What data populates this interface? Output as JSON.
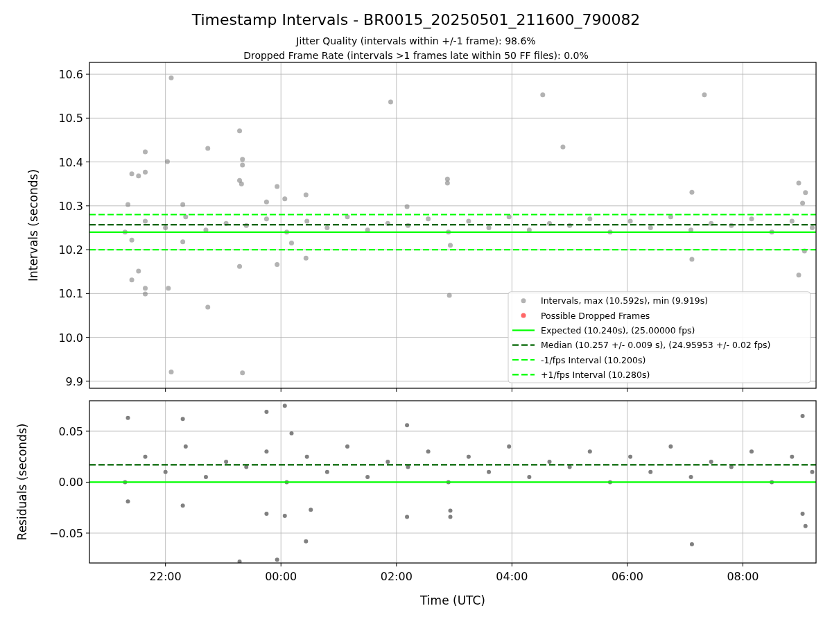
{
  "figure": {
    "title": "Timestamp Intervals - BR0015_20250501_211600_790082",
    "subtitles": [
      "Jitter Quality (intervals within +/-1 frame): 98.6%",
      "Dropped Frame Rate (intervals >1 frames late within 50 FF files): 0.0%"
    ]
  },
  "panels": [
    {
      "chart_data": {
        "type": "scatter",
        "ylabel": "Intervals (seconds)",
        "grid": true,
        "legend": true,
        "xlim": [
          "2025-05-01T20:41",
          "2025-05-02T09:16"
        ],
        "ylim": [
          9.884,
          10.627
        ],
        "yticks": [
          {
            "value": 9.9,
            "label": "9.9"
          },
          {
            "value": 10.0,
            "label": "10.0"
          },
          {
            "value": 10.1,
            "label": "10.1"
          },
          {
            "value": 10.2,
            "label": "10.2"
          },
          {
            "value": 10.3,
            "label": "10.3"
          },
          {
            "value": 10.4,
            "label": "10.4"
          },
          {
            "value": 10.5,
            "label": "10.5"
          },
          {
            "value": 10.6,
            "label": "10.6"
          }
        ],
        "series": [
          {
            "name": "Intervals, max (10.592s), min (9.919s)",
            "color": "#808080",
            "x": [
              "2025-05-01T21:18",
              "2025-05-01T21:39",
              "2025-05-01T22:00",
              "2025-05-01T22:21",
              "2025-05-01T22:42",
              "2025-05-01T23:03",
              "2025-05-01T23:24",
              "2025-05-01T23:45",
              "2025-05-02T00:06",
              "2025-05-02T00:27",
              "2025-05-02T00:48",
              "2025-05-02T01:09",
              "2025-05-02T01:30",
              "2025-05-02T01:51",
              "2025-05-02T02:12",
              "2025-05-02T02:33",
              "2025-05-02T02:54",
              "2025-05-02T03:15",
              "2025-05-02T03:36",
              "2025-05-02T03:57",
              "2025-05-02T04:18",
              "2025-05-02T04:39",
              "2025-05-02T05:00",
              "2025-05-02T05:21",
              "2025-05-02T05:42",
              "2025-05-02T06:03",
              "2025-05-02T06:24",
              "2025-05-02T06:45",
              "2025-05-02T07:06",
              "2025-05-02T07:27",
              "2025-05-02T07:48",
              "2025-05-02T08:09",
              "2025-05-02T08:30",
              "2025-05-02T08:51",
              "2025-05-02T09:12",
              "2025-05-01T21:21",
              "2025-05-01T21:25",
              "2025-05-01T21:25",
              "2025-05-01T21:25",
              "2025-05-01T21:32",
              "2025-05-01T21:32",
              "2025-05-01T21:39",
              "2025-05-01T21:39",
              "2025-05-01T21:39",
              "2025-05-01T21:39",
              "2025-05-01T22:02",
              "2025-05-01T22:06",
              "2025-05-01T22:03",
              "2025-05-01T22:06",
              "2025-05-01T22:18",
              "2025-05-01T22:18",
              "2025-05-01T22:44",
              "2025-05-01T22:44",
              "2025-05-01T23:17",
              "2025-05-01T23:20",
              "2025-05-01T23:20",
              "2025-05-01T23:17",
              "2025-05-01T23:19",
              "2025-05-01T23:17",
              "2025-05-01T23:20",
              "2025-05-01T23:45",
              "2025-05-01T23:56",
              "2025-05-01T23:56",
              "2025-05-02T00:04",
              "2025-05-02T00:11",
              "2025-05-02T00:26",
              "2025-05-02T00:26",
              "2025-05-02T01:54",
              "2025-05-02T02:11",
              "2025-05-02T02:53",
              "2025-05-02T02:53",
              "2025-05-02T02:55",
              "2025-05-02T02:56",
              "2025-05-02T04:32",
              "2025-05-02T04:53",
              "2025-05-02T07:07",
              "2025-05-02T07:07",
              "2025-05-02T07:20",
              "2025-05-02T08:58",
              "2025-05-02T08:58",
              "2025-05-02T09:02",
              "2025-05-02T09:05",
              "2025-05-02T09:04"
            ],
            "values": [
              10.24,
              10.265,
              10.25,
              10.275,
              10.245,
              10.26,
              10.255,
              10.27,
              10.24,
              10.265,
              10.25,
              10.275,
              10.245,
              10.26,
              10.255,
              10.27,
              10.24,
              10.265,
              10.25,
              10.275,
              10.245,
              10.26,
              10.255,
              10.27,
              10.24,
              10.265,
              10.25,
              10.275,
              10.245,
              10.26,
              10.255,
              10.27,
              10.24,
              10.265,
              10.25,
              10.303,
              10.373,
              10.222,
              10.131,
              10.368,
              10.151,
              10.377,
              10.423,
              10.112,
              10.099,
              10.401,
              10.592,
              10.112,
              9.921,
              10.303,
              10.218,
              10.431,
              10.069,
              10.471,
              10.406,
              10.393,
              10.358,
              10.35,
              10.162,
              9.919,
              10.309,
              10.344,
              10.166,
              10.316,
              10.215,
              10.325,
              10.181,
              10.537,
              10.298,
              10.361,
              10.352,
              10.096,
              10.21,
              10.553,
              10.434,
              10.331,
              10.178,
              10.553,
              10.352,
              10.142,
              10.306,
              10.33,
              10.197
            ]
          },
          {
            "name": "Possible Dropped Frames",
            "color": "#ff0000"
          }
        ],
        "ref_lines": [
          {
            "axis": "y",
            "value": 10.24,
            "label": "Expected (10.240s), (25.00000 fps)",
            "color": "#00ff00"
          },
          {
            "axis": "y",
            "value": 10.257,
            "label": "Median (10.257 +/- 0.009 s), (24.95953 +/- 0.02 fps)",
            "color": "#006400"
          },
          {
            "axis": "y",
            "value": 10.2,
            "label": "-1/fps Interval (10.200s)",
            "color": "#00ff00"
          },
          {
            "axis": "y",
            "value": 10.28,
            "label": "+1/fps Interval (10.280s)",
            "color": "#00ff00"
          }
        ]
      }
    },
    {
      "chart_data": {
        "type": "scatter",
        "xlabel": "Time (UTC)",
        "ylabel": "Residuals (seconds)",
        "grid": true,
        "xlim": [
          "2025-05-01T20:41",
          "2025-05-02T09:16"
        ],
        "ylim": [
          -0.0793,
          0.0799
        ],
        "xticks": [
          {
            "value": "2025-05-01T22:00",
            "label": "22:00"
          },
          {
            "value": "2025-05-02T00:00",
            "label": "00:00"
          },
          {
            "value": "2025-05-02T02:00",
            "label": "02:00"
          },
          {
            "value": "2025-05-02T04:00",
            "label": "04:00"
          },
          {
            "value": "2025-05-02T06:00",
            "label": "06:00"
          },
          {
            "value": "2025-05-02T08:00",
            "label": "08:00"
          }
        ],
        "yticks": [
          {
            "value": -0.05,
            "label": "−0.05"
          },
          {
            "value": 0,
            "label": "0.00"
          },
          {
            "value": 0.05,
            "label": "0.05"
          }
        ],
        "series": [
          {
            "color": "#808080",
            "x": [
              "2025-05-01T21:18",
              "2025-05-01T21:39",
              "2025-05-01T22:00",
              "2025-05-01T22:21",
              "2025-05-01T22:42",
              "2025-05-01T23:03",
              "2025-05-01T23:24",
              "2025-05-01T23:45",
              "2025-05-02T00:06",
              "2025-05-02T00:27",
              "2025-05-02T00:48",
              "2025-05-02T01:09",
              "2025-05-02T01:30",
              "2025-05-02T01:51",
              "2025-05-02T02:12",
              "2025-05-02T02:33",
              "2025-05-02T02:54",
              "2025-05-02T03:15",
              "2025-05-02T03:36",
              "2025-05-02T03:57",
              "2025-05-02T04:18",
              "2025-05-02T04:39",
              "2025-05-02T05:00",
              "2025-05-02T05:21",
              "2025-05-02T05:42",
              "2025-05-02T06:03",
              "2025-05-02T06:24",
              "2025-05-02T06:45",
              "2025-05-02T07:06",
              "2025-05-02T07:27",
              "2025-05-02T07:48",
              "2025-05-02T08:09",
              "2025-05-02T08:30",
              "2025-05-02T08:51",
              "2025-05-02T09:12",
              "2025-05-01T21:21",
              "2025-05-01T21:21",
              "2025-05-01T22:18",
              "2025-05-01T22:18",
              "2025-05-01T23:45",
              "2025-05-01T23:45",
              "2025-05-02T00:04",
              "2025-05-02T00:04",
              "2025-05-02T00:11",
              "2025-05-02T00:31",
              "2025-05-02T00:26",
              "2025-05-01T23:17",
              "2025-05-01T23:56",
              "2025-05-02T02:11",
              "2025-05-02T02:11",
              "2025-05-02T02:56",
              "2025-05-02T02:56",
              "2025-05-02T07:07",
              "2025-05-02T09:02",
              "2025-05-02T09:02",
              "2025-05-02T09:05"
            ],
            "values": [
              0.0,
              0.025,
              0.01,
              0.035,
              0.005,
              0.02,
              0.015,
              0.03,
              0.0,
              0.025,
              0.01,
              0.035,
              0.005,
              0.02,
              0.015,
              0.03,
              0.0,
              0.025,
              0.01,
              0.035,
              0.005,
              0.02,
              0.015,
              0.03,
              0.0,
              0.025,
              0.01,
              0.035,
              0.005,
              0.02,
              0.015,
              0.03,
              0.0,
              0.025,
              0.01,
              0.063,
              -0.019,
              0.062,
              -0.023,
              0.069,
              -0.031,
              0.075,
              -0.033,
              0.048,
              -0.027,
              -0.058,
              -0.078,
              -0.076,
              0.056,
              -0.034,
              -0.028,
              -0.034,
              -0.061,
              0.065,
              -0.031,
              -0.043
            ]
          }
        ],
        "ref_lines": [
          {
            "axis": "y",
            "value": 0,
            "color": "#00ff00"
          },
          {
            "axis": "y",
            "value": 0.017,
            "color": "#006400"
          }
        ]
      }
    }
  ]
}
